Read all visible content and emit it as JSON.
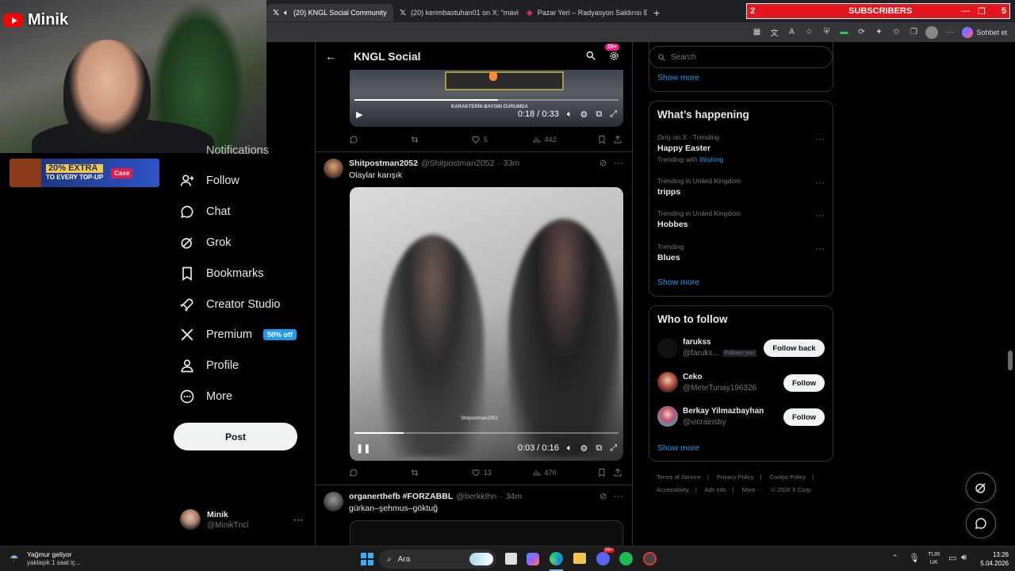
{
  "overlay": {
    "channel_name": "Minik",
    "promo_text": "20% EXTRA",
    "promo_sub": "TO EVERY TOP-UP",
    "promo_brand": "Case",
    "subscribers_count": "2",
    "subscribers_label": "SUBSCRIBERS",
    "subscribers_goal": "5"
  },
  "browser": {
    "tabs": [
      {
        "label": "(20) KNGL Social Community",
        "active": true
      },
      {
        "label": "(20) kerimbastuhan01 on X: \"mavi",
        "active": false
      },
      {
        "label": "Pazar Yeri – Radyasyon Saldırısı Et",
        "active": false
      }
    ],
    "new_tab": "+",
    "copilot_label": "Sohbet et"
  },
  "nav": {
    "partial_label": "Notifications",
    "items": [
      {
        "label": "Follow",
        "icon": "person-add-icon"
      },
      {
        "label": "Chat",
        "icon": "chat-bubble-icon"
      },
      {
        "label": "Grok",
        "icon": "grok-icon"
      },
      {
        "label": "Bookmarks",
        "icon": "bookmark-icon"
      },
      {
        "label": "Creator Studio",
        "icon": "rocket-icon"
      },
      {
        "label": "Premium",
        "icon": "x-logo-icon"
      },
      {
        "label": "Profile",
        "icon": "person-icon"
      },
      {
        "label": "More",
        "icon": "more-circle-icon"
      }
    ],
    "premium_badge": "50% off",
    "post_button": "Post",
    "account": {
      "name": "Minik",
      "handle": "@MinikTncl",
      "more": "···"
    }
  },
  "main": {
    "header_title": "KNGL Social",
    "notif_badge": "20+",
    "video1": {
      "caption": "KARAKTERİN BAYGIN DURUMDA",
      "time": "0:18 / 0:33",
      "progress": 0.545
    },
    "tweet1_actions": {
      "replies": "",
      "reposts": "",
      "likes": "5",
      "views": "442"
    },
    "tweet2": {
      "name": "Shitpostman2052",
      "handle": "@Shitpostman2052",
      "time": "33m",
      "text": "Olaylar karışık",
      "video_watermark": "Shitpostman2052",
      "video_time": "0:03 / 0:16",
      "progress": 0.1875
    },
    "tweet2_actions": {
      "replies": "",
      "reposts": "",
      "likes": "13",
      "views": "470"
    },
    "tweet3": {
      "name": "organerthefb #FORZABBL",
      "handle": "@berkkthn",
      "time": "34m",
      "text": "gürkan–şehmus–göktuğ"
    }
  },
  "right": {
    "search_placeholder": "Search",
    "top_show_more": "Show more",
    "whats_happening": {
      "title": "What’s happening",
      "trends": [
        {
          "meta": "Only on X · Trending",
          "name": "Happy Easter",
          "extra_prefix": "Trending with",
          "extra_link": "Wishing"
        },
        {
          "meta": "Trending in United Kingdom",
          "name": "tripps"
        },
        {
          "meta": "Trending in United Kingdom",
          "name": "Hobbes"
        },
        {
          "meta": "Trending",
          "name": "Blues"
        }
      ],
      "show_more": "Show more"
    },
    "who_to_follow": {
      "title": "Who to follow",
      "accounts": [
        {
          "name": "farukss",
          "handle": "@faruks...",
          "follows_you": "Follows you",
          "button": "Follow back"
        },
        {
          "name": "Ceko",
          "handle": "@MeteTunay196326",
          "button": "Follow"
        },
        {
          "name": "Berkay Yilmazbayhan",
          "handle": "@vicrainsby",
          "button": "Follow"
        }
      ],
      "show_more": "Show more"
    },
    "footer": [
      "Terms of Service",
      "|",
      "Privacy Policy",
      "|",
      "Cookie Policy",
      "|",
      "Accessibility",
      "|",
      "Ads info",
      "|",
      "More ···",
      "© 2026 X Corp."
    ]
  },
  "taskbar": {
    "weather_title": "Yağmur geliyor",
    "weather_sub": "yaklaşık 1 saat iç...",
    "search_label": "Ara",
    "lang_top": "TUR",
    "lang_bottom": "UK",
    "time": "13:26",
    "date": "5.04.2026",
    "discord_badge": "99+"
  },
  "colors": {
    "accent": "#1d9bf0",
    "subs_bar": "#e4161d",
    "border": "#2f3336",
    "muted": "#71767b"
  }
}
